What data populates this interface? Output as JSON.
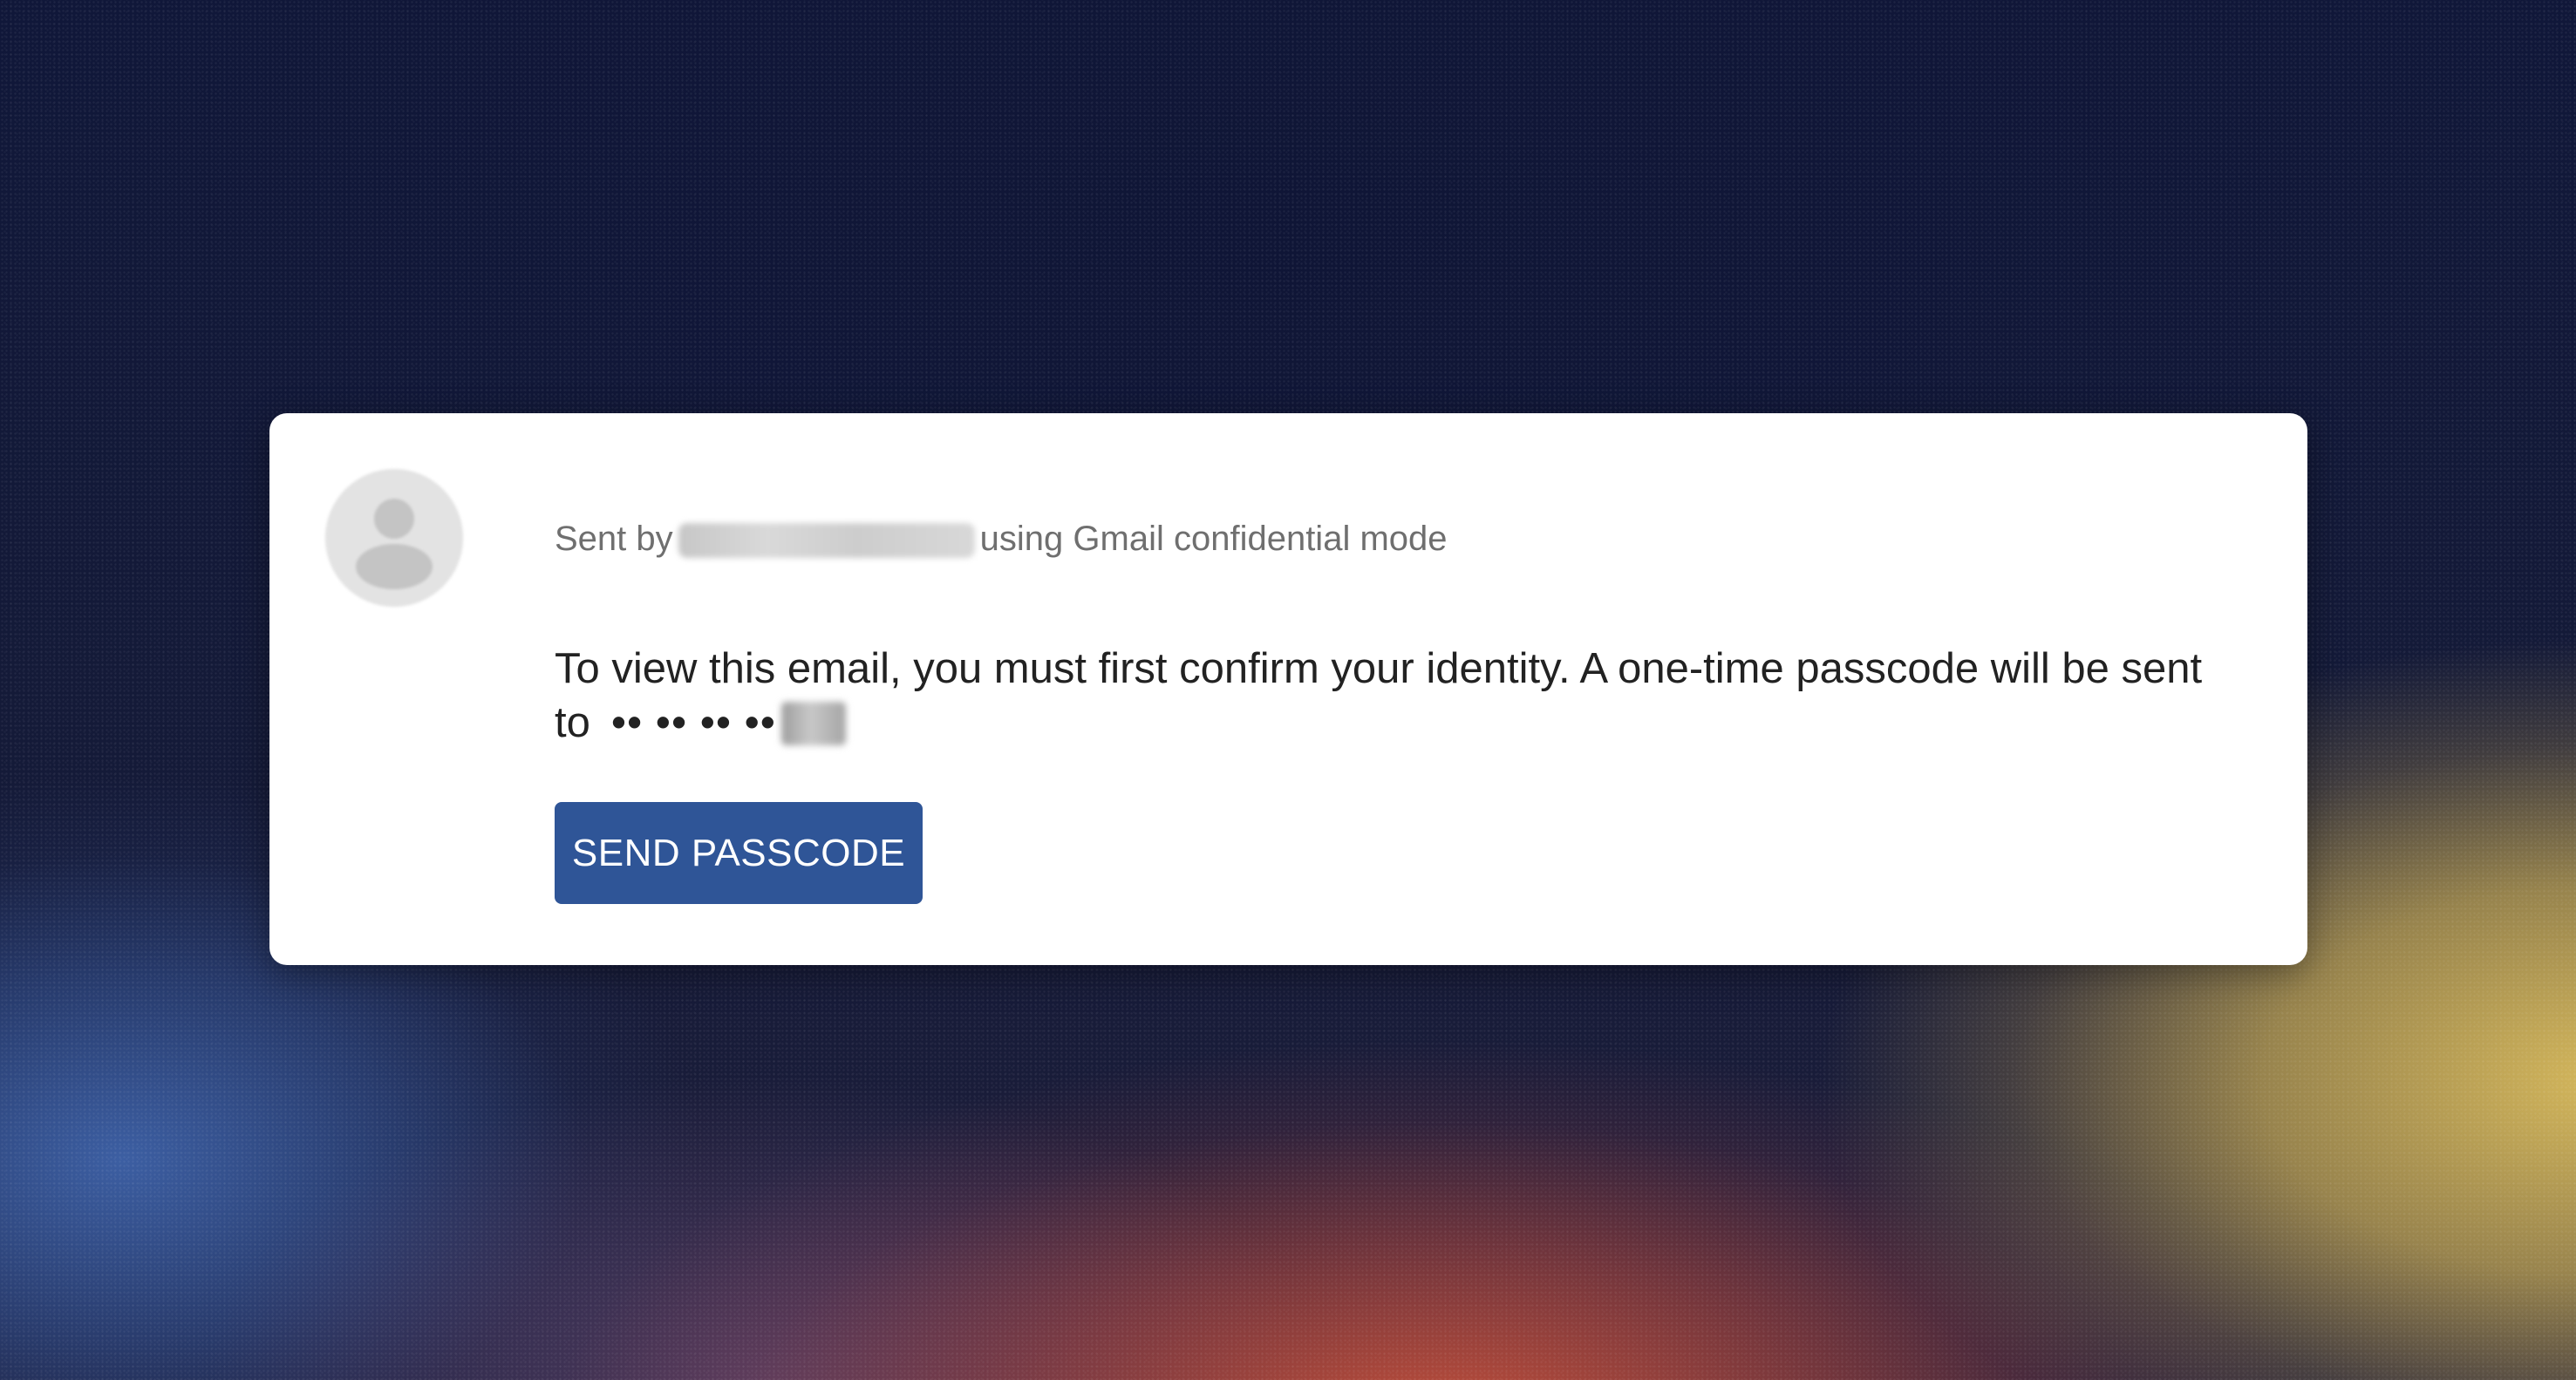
{
  "sender": {
    "prefix": "Sent by",
    "suffix": "using Gmail confidential mode"
  },
  "message": {
    "body": "To view this email, you must first confirm your identity. A one-time passcode will be sent to",
    "masked_number": "•• •• •• ••"
  },
  "actions": {
    "send_passcode_label": "SEND PASSCODE"
  },
  "colors": {
    "button": "#2f5597",
    "card": "#ffffff",
    "background_top": "#101735"
  },
  "icons": {
    "avatar": "person-placeholder-icon"
  }
}
